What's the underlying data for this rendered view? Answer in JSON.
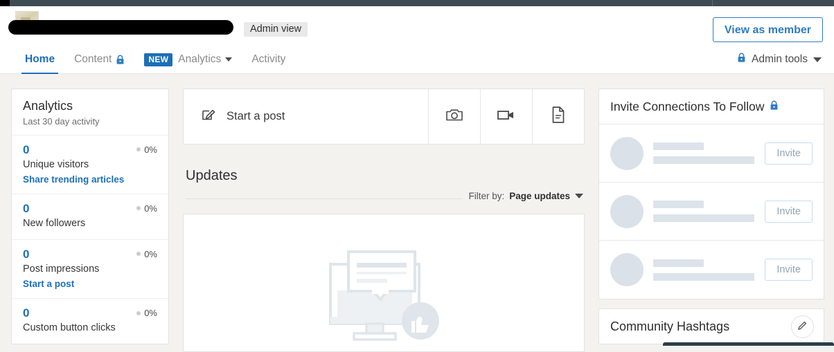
{
  "header": {
    "org_name_redacted": "",
    "admin_view_badge": "Admin view",
    "view_as_member_label": "View as member",
    "logo_icon": "company-logo-thumbnail"
  },
  "nav": {
    "tabs": [
      {
        "label": "Home",
        "active": true,
        "lock": false,
        "caret": false,
        "badge": ""
      },
      {
        "label": "Content",
        "active": false,
        "lock": true,
        "caret": false,
        "badge": ""
      },
      {
        "label": "Analytics",
        "active": false,
        "lock": false,
        "caret": true,
        "badge": "NEW"
      },
      {
        "label": "Activity",
        "active": false,
        "lock": false,
        "caret": false,
        "badge": ""
      }
    ],
    "admin_tools_label": "Admin tools",
    "admin_tools_lock_icon": "lock-icon",
    "admin_tools_caret_icon": "chevron-down-icon"
  },
  "analytics": {
    "title": "Analytics",
    "subtitle": "Last 30 day activity",
    "stats": [
      {
        "value": "0",
        "delta": "0%",
        "label": "Unique visitors",
        "link": "Share trending articles"
      },
      {
        "value": "0",
        "delta": "0%",
        "label": "New followers",
        "link": ""
      },
      {
        "value": "0",
        "delta": "0%",
        "label": "Post impressions",
        "link": "Start a post"
      },
      {
        "value": "0",
        "delta": "0%",
        "label": "Custom button clicks",
        "link": ""
      }
    ]
  },
  "composer": {
    "start_post_label": "Start a post",
    "write_icon": "write-post-icon",
    "actions": [
      {
        "icon": "camera-icon",
        "name": "add-photo-button"
      },
      {
        "icon": "video-camera-icon",
        "name": "add-video-button"
      },
      {
        "icon": "document-icon",
        "name": "add-document-button"
      }
    ]
  },
  "updates": {
    "title": "Updates",
    "filter_label": "Filter by:",
    "filter_value": "Page updates",
    "filter_caret_icon": "chevron-down-icon",
    "empty_illustration": "desktop-monitor-with-post-and-thumbs-up-illustration"
  },
  "invite": {
    "title": "Invite Connections To Follow",
    "lock_icon": "lock-icon",
    "rows": [
      {
        "button_label": "Invite",
        "name_placeholder": "",
        "headline_placeholder": ""
      },
      {
        "button_label": "Invite",
        "name_placeholder": "",
        "headline_placeholder": ""
      },
      {
        "button_label": "Invite",
        "name_placeholder": "",
        "headline_placeholder": ""
      }
    ]
  },
  "hashtags": {
    "title": "Community Hashtags",
    "edit_icon": "pencil-edit-icon"
  },
  "colors": {
    "page_background": "#f3f2ef",
    "card_background": "#ffffff",
    "link_blue": "#1d6fb8",
    "accent_blue": "#2e7cc3",
    "chrome_dark": "#3d4b53",
    "skeleton_gray": "#dde3ea",
    "tooltip_dark": "#2c3e4a"
  }
}
